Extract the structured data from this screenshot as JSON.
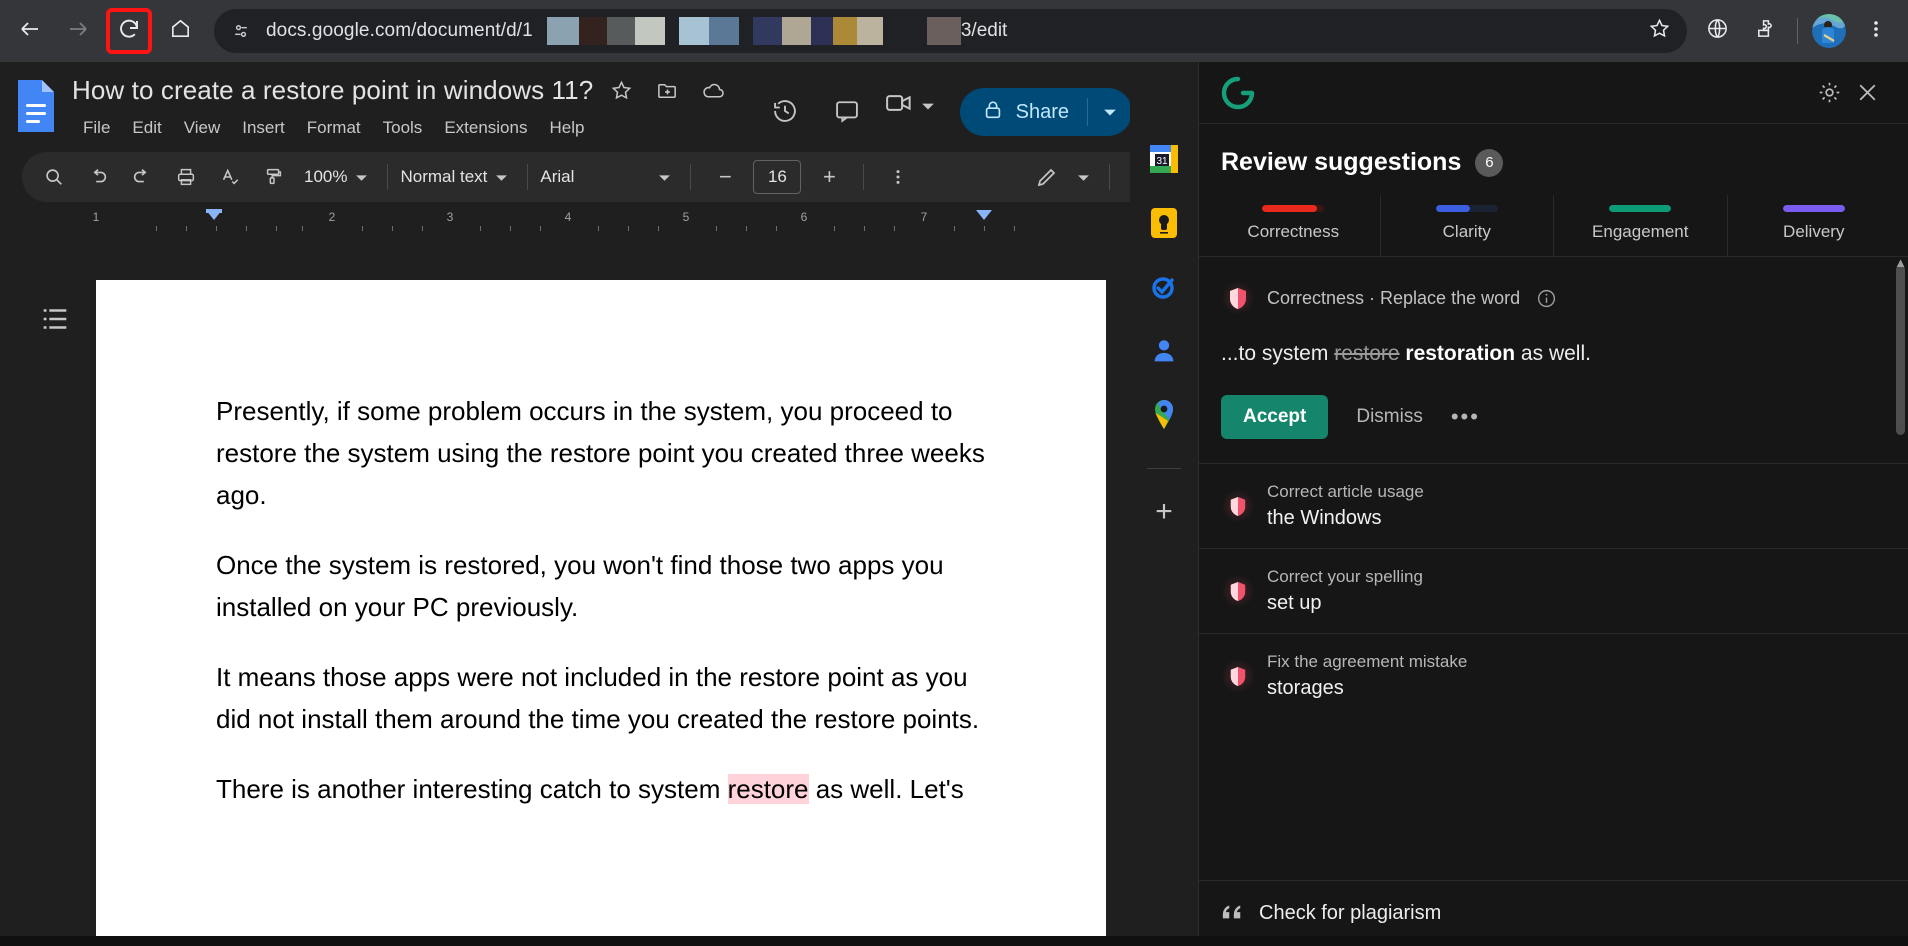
{
  "browser": {
    "back_icon": "back-arrow-icon",
    "forward_icon": "forward-arrow-icon",
    "reload_icon": "reload-icon",
    "home_icon": "home-icon",
    "site_info_icon": "site-settings-icon",
    "url_prefix": "docs.google.com/document/d/1",
    "url_suffix": "3/edit",
    "redaction_colors_group1": [
      "#8ba3b0",
      "#33231f",
      "#585b5c",
      "#c2c7bf"
    ],
    "redaction_colors_group2": [
      "#a7c2d2",
      "#5c7897"
    ],
    "redaction_colors_group3": [
      "#32395e",
      "#b0a694",
      "#2b3054",
      "#ab8936",
      "#bcb39f"
    ],
    "redaction_color_tail": "#6b5f5d",
    "star_icon": "bookmark-star-icon",
    "globe_icon": "globe-icon",
    "extensions_icon": "extensions-puzzle-icon",
    "profile_icon": "profile-avatar",
    "menu_icon": "three-dot-menu-icon",
    "highlight_color": "#ff1414"
  },
  "docs": {
    "logo_icon": "google-docs-logo",
    "title": "How to create a restore point in windows 11?",
    "star_icon": "star-icon",
    "move_icon": "move-to-folder-icon",
    "cloud_icon": "saved-to-drive-icon",
    "menus": [
      "File",
      "Edit",
      "View",
      "Insert",
      "Format",
      "Tools",
      "Extensions",
      "Help"
    ],
    "history_icon": "version-history-icon",
    "comment_icon": "comment-history-icon",
    "video_icon": "video-call-icon",
    "share_label": "Share",
    "share_lock_icon": "lock-icon",
    "share_caret_icon": "chevron-down-icon",
    "avatar_icon": "user-avatar",
    "toolbar": {
      "search_icon": "search-icon",
      "undo_icon": "undo-icon",
      "redo_icon": "redo-icon",
      "print_icon": "print-icon",
      "spellcheck_icon": "spellcheck-icon",
      "paint_format_icon": "paint-format-icon",
      "zoom_value": "100%",
      "zoom_caret_icon": "chevron-down-icon",
      "style_value": "Normal text",
      "style_caret_icon": "chevron-down-icon",
      "font_value": "Arial",
      "font_caret_icon": "chevron-down-icon",
      "font_size_decrease": "−",
      "font_size_value": "16",
      "font_size_increase": "+",
      "more_icon": "more-vertical-icon",
      "pen_icon": "editing-mode-pen-icon",
      "pen_caret_icon": "chevron-down-icon",
      "collapse_icon": "chevron-up-icon"
    },
    "ruler": {
      "numbers": [
        "1",
        "2",
        "3",
        "4",
        "5",
        "6",
        "7"
      ],
      "left_marker_icon": "indent-marker-left",
      "right_marker_icon": "indent-marker-right"
    },
    "outline_icon": "document-outline-icon",
    "paragraphs": [
      "Presently, if some problem occurs in the system, you proceed to restore the system using the restore point you created three weeks ago.",
      "Once the system is restored, you won't find those two apps you installed on your PC previously.",
      "It means those apps were not included in the restore point as you did not install them around the time you created the restore points."
    ],
    "partial_paragraph": {
      "before": "There is another interesting catch to system ",
      "highlight": "restore",
      "after": " as well. Let's"
    },
    "side_rail": [
      "google-calendar-icon",
      "google-keep-icon",
      "google-tasks-icon",
      "contacts-icon",
      "google-maps-icon",
      "add-ons-plus-icon"
    ]
  },
  "grammarly": {
    "logo_icon": "grammarly-logo-icon",
    "settings_icon": "gear-icon",
    "close_icon": "close-icon",
    "heading": "Review suggestions",
    "count": "6",
    "tabs": [
      {
        "label": "Correctness",
        "color": "#e8291c",
        "fill": 88
      },
      {
        "label": "Clarity",
        "color": "#3b5fe0",
        "fill": 55
      },
      {
        "label": "Engagement",
        "color": "#0d9b76",
        "fill": 100
      },
      {
        "label": "Delivery",
        "color": "#7b5cf0",
        "fill": 100
      }
    ],
    "active_card": {
      "shield_icon": "correctness-shield-icon",
      "category": "Correctness · Replace the word",
      "info_icon": "info-icon",
      "text_before": "...to system ",
      "text_strike": "restore",
      "text_fix": "restoration",
      "text_after": " as well.",
      "accept_label": "Accept",
      "dismiss_label": "Dismiss",
      "more_label": "•••",
      "accept_color": "#15866b"
    },
    "suggestions": [
      {
        "icon": "correctness-shield-icon",
        "title": "Correct article usage",
        "value": "the Windows"
      },
      {
        "icon": "correctness-shield-icon",
        "title": "Correct your spelling",
        "value": "set up"
      },
      {
        "icon": "correctness-shield-icon",
        "title": "Fix the agreement mistake",
        "value": "storages"
      }
    ],
    "footer": {
      "icon": "quote-icon",
      "label": "Check for plagiarism"
    }
  }
}
